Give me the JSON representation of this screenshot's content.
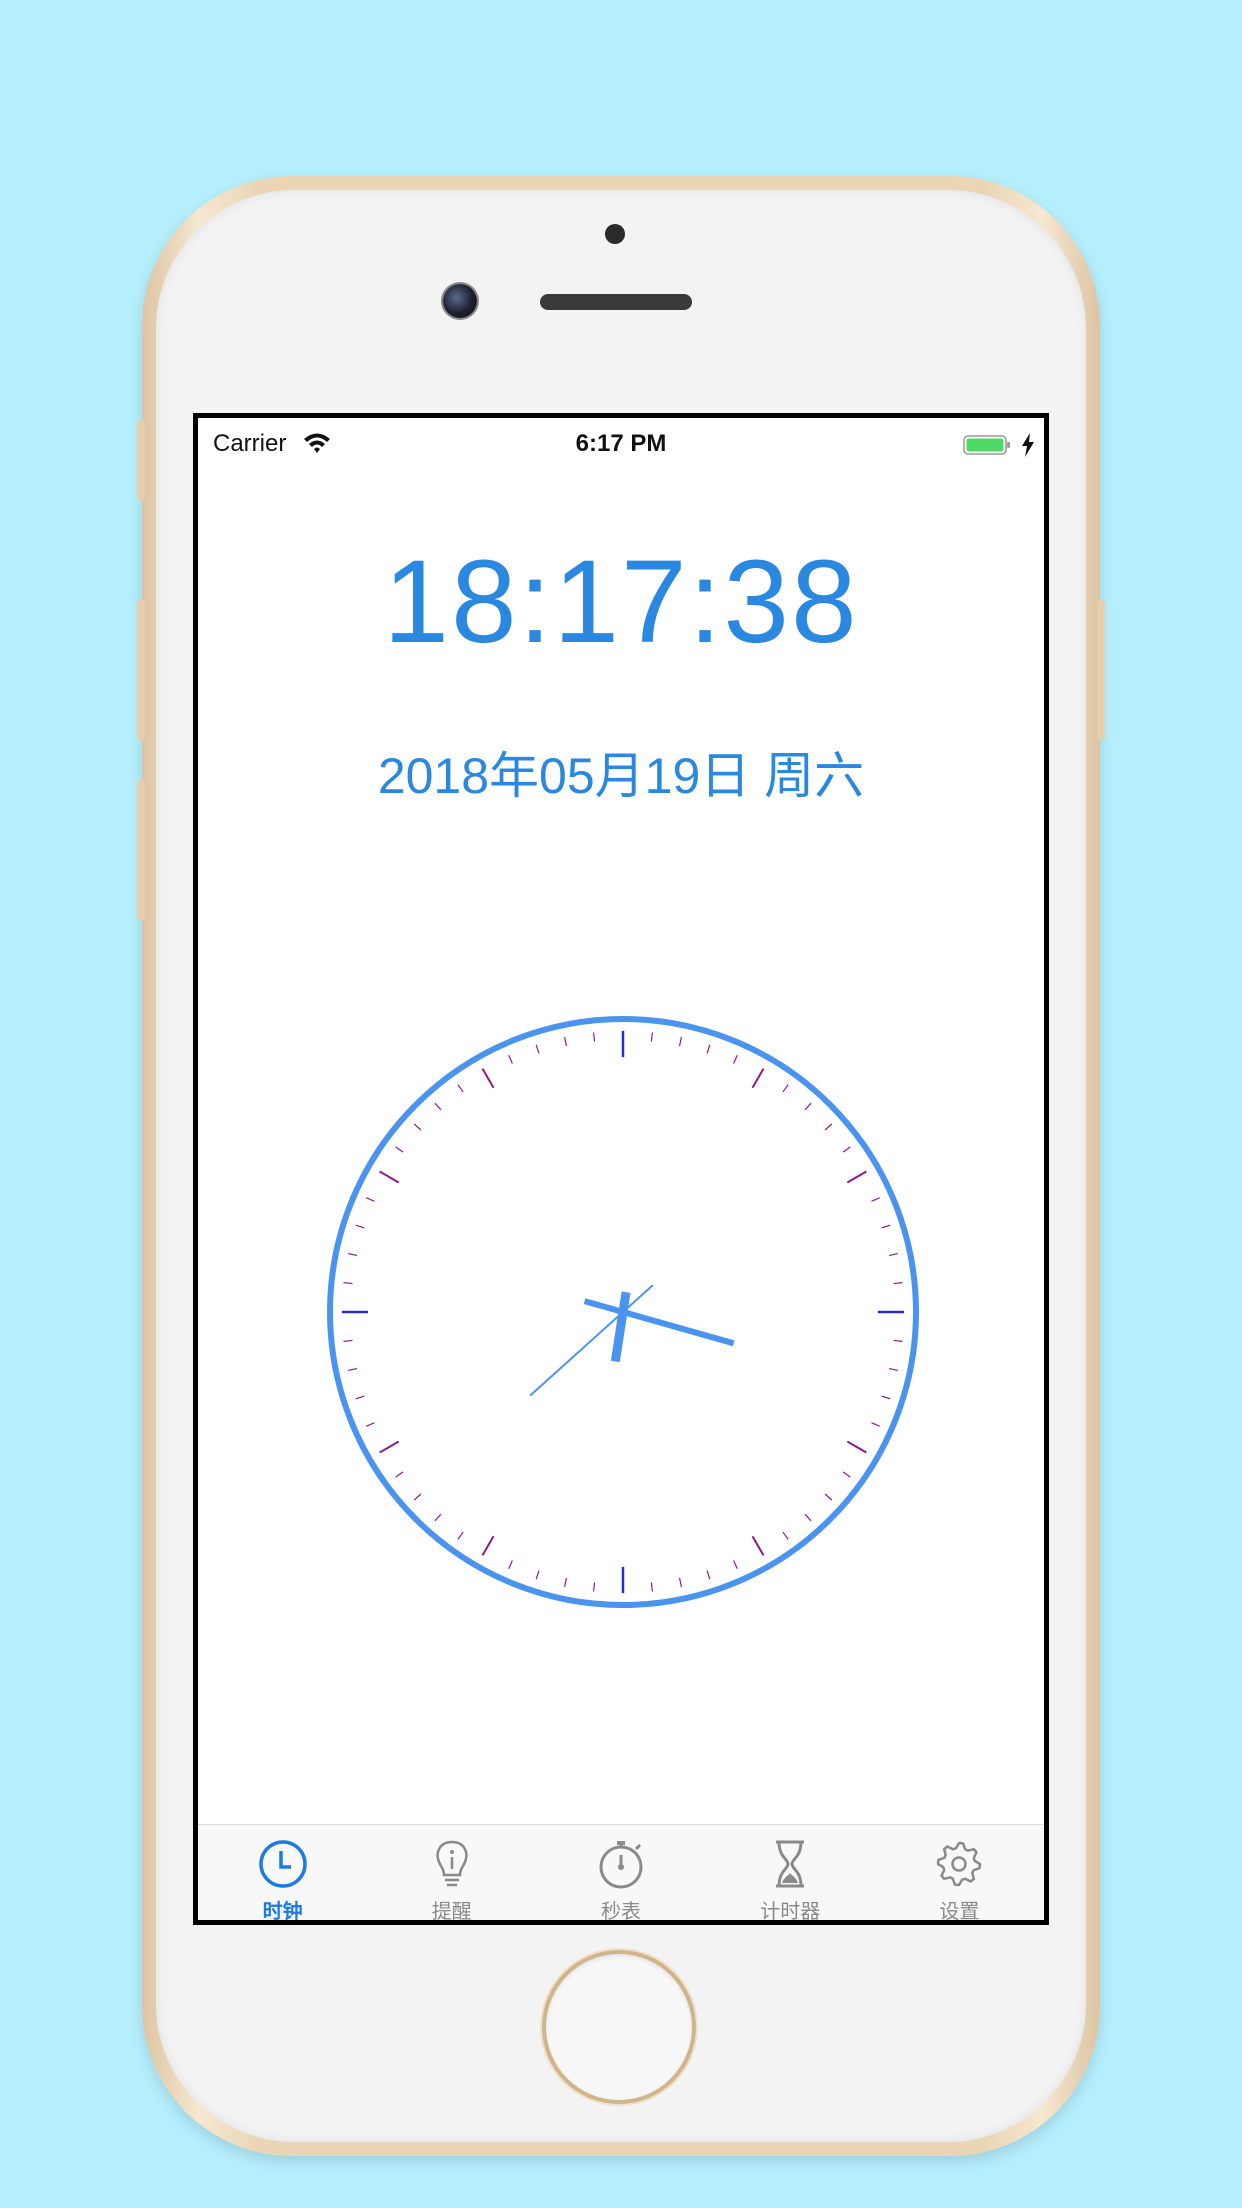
{
  "status_bar": {
    "carrier": "Carrier",
    "time": "6:17 PM"
  },
  "clock": {
    "digital_time": "18:17:38",
    "date": "2018年05月19日  周六",
    "hour": 18,
    "minute": 17,
    "second": 38
  },
  "tabs": [
    {
      "label": "时钟",
      "icon": "clock-icon",
      "active": true
    },
    {
      "label": "提醒",
      "icon": "lightbulb-icon",
      "active": false
    },
    {
      "label": "秒表",
      "icon": "stopwatch-icon",
      "active": false
    },
    {
      "label": "计时器",
      "icon": "hourglass-icon",
      "active": false
    },
    {
      "label": "设置",
      "icon": "gear-icon",
      "active": false
    }
  ],
  "colors": {
    "accent": "#2a88e0",
    "dial_ring": "#4a94ef",
    "tick_major": "#2a2ad0",
    "tick_minor": "#8a1a8a",
    "tab_active": "#1a7ae6",
    "tab_inactive": "#8a8a8a",
    "background": "#b5eefc"
  }
}
